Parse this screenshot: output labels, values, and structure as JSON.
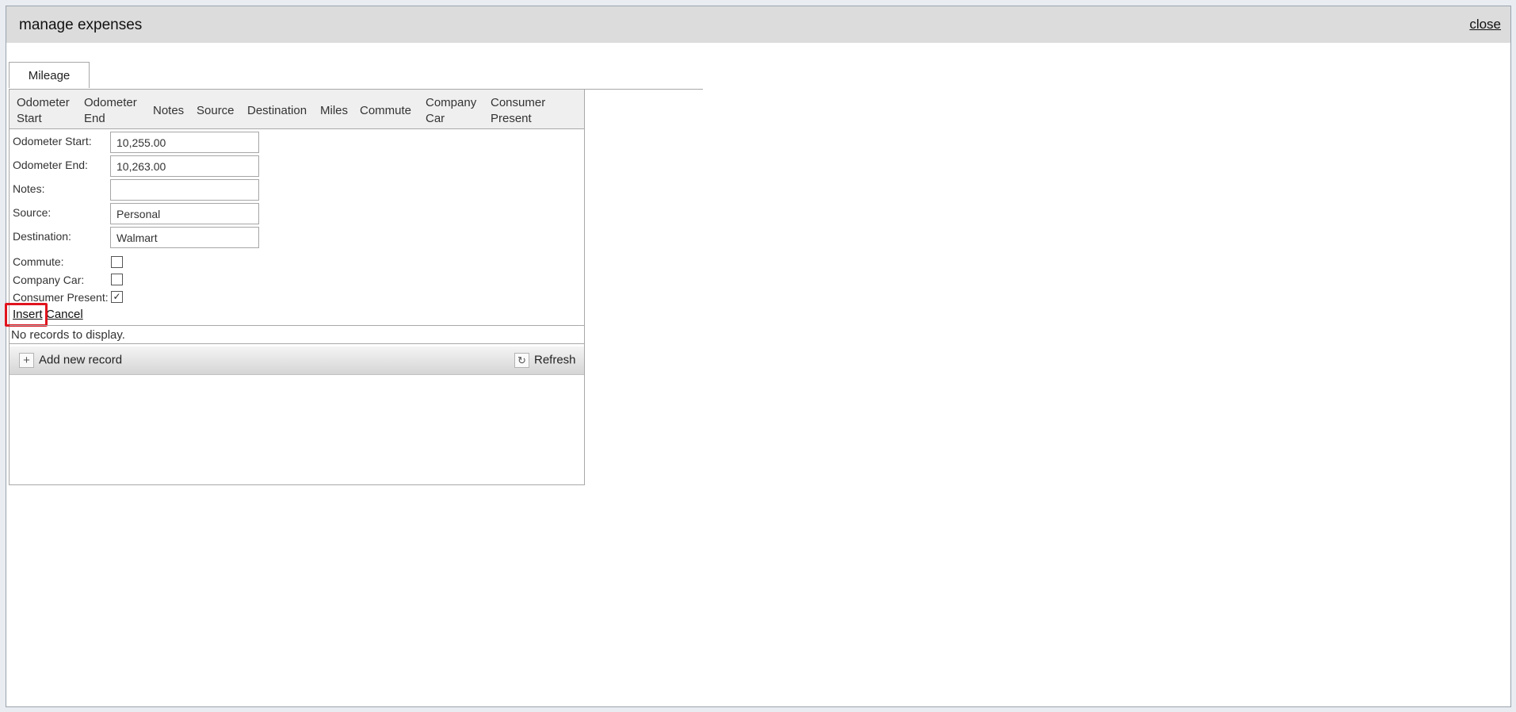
{
  "dialog": {
    "title": "manage expenses",
    "close_label": "close"
  },
  "tabs": [
    {
      "label": "Mileage",
      "selected": true
    }
  ],
  "grid": {
    "columns": [
      {
        "line1": "Odometer",
        "line2": "Start"
      },
      {
        "line1": "Odometer",
        "line2": "End"
      },
      {
        "line1": "Notes",
        "line2": ""
      },
      {
        "line1": "Source",
        "line2": ""
      },
      {
        "line1": "Destination",
        "line2": ""
      },
      {
        "line1": "Miles",
        "line2": ""
      },
      {
        "line1": "Commute",
        "line2": ""
      },
      {
        "line1": "Company",
        "line2": "Car"
      },
      {
        "line1": "Consumer",
        "line2": "Present"
      }
    ],
    "no_records": "No records to display.",
    "add_new_label": "Add new record",
    "refresh_label": "Refresh",
    "add_icon": "plus-icon",
    "refresh_icon": "refresh-icon"
  },
  "form": {
    "odometer_start": {
      "label": "Odometer Start:",
      "value": "10,255.00"
    },
    "odometer_end": {
      "label": "Odometer End:",
      "value": "10,263.00"
    },
    "notes": {
      "label": "Notes:",
      "value": ""
    },
    "source": {
      "label": "Source:",
      "value": "Personal"
    },
    "destination": {
      "label": "Destination:",
      "value": "Walmart"
    },
    "commute": {
      "label": "Commute:",
      "checked": false
    },
    "company_car": {
      "label": "Company Car:",
      "checked": false
    },
    "consumer_present": {
      "label": "Consumer Present:",
      "checked": true
    },
    "insert_label": "Insert",
    "cancel_label": "Cancel"
  },
  "colors": {
    "highlight": "#e0141e",
    "titlebar": "#dcdcdc"
  }
}
